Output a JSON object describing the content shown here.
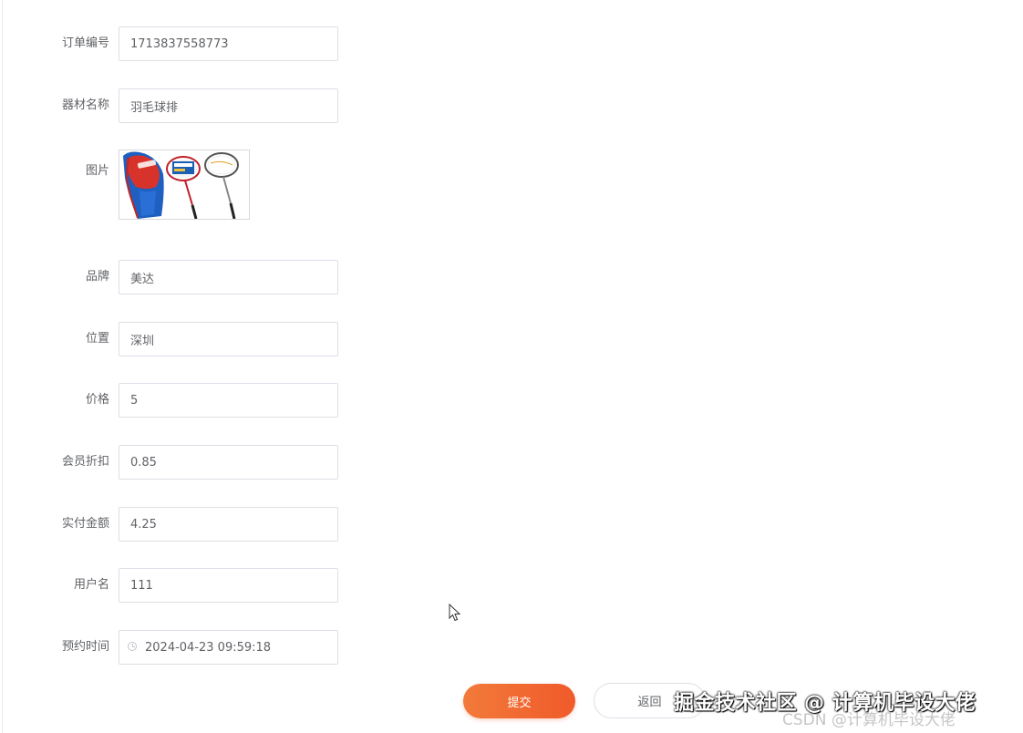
{
  "form": {
    "fields": [
      {
        "label": "订单编号",
        "value": "1713837558773"
      },
      {
        "label": "器材名称",
        "value": "羽毛球排"
      },
      {
        "label": "品牌",
        "value": "美达"
      },
      {
        "label": "位置",
        "value": "深圳"
      },
      {
        "label": "价格",
        "value": "5"
      },
      {
        "label": "会员折扣",
        "value": "0.85"
      },
      {
        "label": "实付金额",
        "value": "4.25"
      },
      {
        "label": "用户名",
        "value": "111"
      },
      {
        "label": "预约时间",
        "value": "2024-04-23 09:59:18"
      }
    ],
    "picture_label": "图片"
  },
  "buttons": {
    "submit_label": "提交",
    "back_label": "返回"
  },
  "watermark": {
    "main": "掘金技术社区 @ 计算机毕设大佬",
    "sub": "CSDN @计算机毕设大佬"
  },
  "colors": {
    "accent": "#f05a2a",
    "border": "#dcdfe6",
    "label": "#606266"
  },
  "icons": {
    "date_icon": "clock-icon",
    "cursor": "mouse-pointer-icon"
  }
}
